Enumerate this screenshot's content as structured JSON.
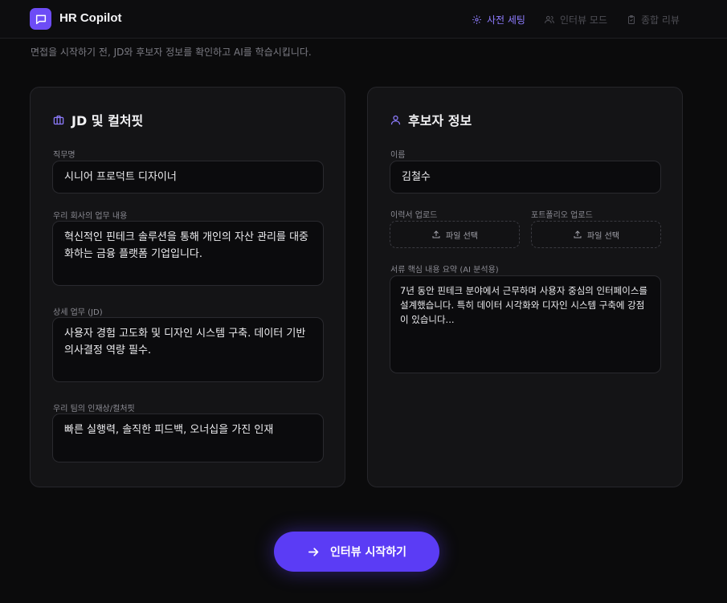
{
  "app": {
    "title": "HR Copilot"
  },
  "nav": {
    "items": [
      {
        "label": "사전 세팅",
        "icon": "gear-icon",
        "active": true
      },
      {
        "label": "인터뷰 모드",
        "icon": "users-icon",
        "active": false
      },
      {
        "label": "종합 리뷰",
        "icon": "clipboard-icon",
        "active": false
      }
    ]
  },
  "intro": "면접을 시작하기 전, JD와 후보자 정보를 확인하고 AI를 학습시킵니다.",
  "jd_card": {
    "title": "JD 및 컬처핏",
    "icon": "briefcase-icon",
    "fields": [
      {
        "label": "직무명",
        "value": "시니어 프로덕트 디자이너"
      },
      {
        "label": "우리 회사의 업무 내용",
        "value": "혁신적인 핀테크 솔루션을 통해 개인의 자산 관리를 대중화하는 금융 플랫폼 기업입니다."
      },
      {
        "label": "상세 업무 (JD)",
        "value": "사용자 경험 고도화 및 디자인 시스템 구축. 데이터 기반 의사결정 역량 필수."
      },
      {
        "label": "우리 팀의 인재상/컬처핏",
        "value": "빠른 실행력, 솔직한 피드백, 오너십을 가진 인재"
      }
    ]
  },
  "candidate_card": {
    "title": "후보자 정보",
    "icon": "user-icon",
    "name_label": "이름",
    "name_value": "김철수",
    "resume_upload_label": "이력서 업로드",
    "portfolio_upload_label": "포트폴리오 업로드",
    "file_select_label": "파일 선택",
    "summary_label": "서류 핵심 내용 요약 (AI 분석용)",
    "summary_value": "7년 동안 핀테크 분야에서 근무하며 사용자 중심의 인터페이스를 설계했습니다. 특히 데이터 시각화와 디자인 시스템 구축에 강점이 있습니다..."
  },
  "start_button": {
    "label": "인터뷰 시작하기"
  },
  "colors": {
    "accent": "#5b3cf5",
    "accent_text": "#8e7cff",
    "background": "#0b0b0c",
    "card": "#141416"
  }
}
